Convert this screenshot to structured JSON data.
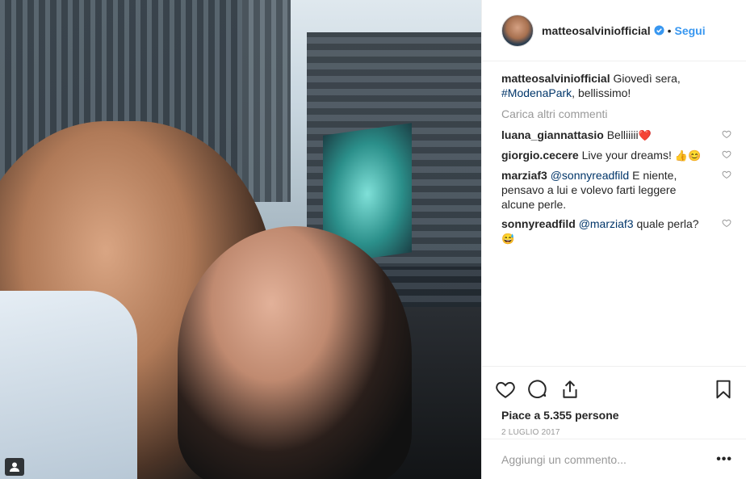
{
  "post": {
    "username": "matteosalviniofficial",
    "follow_label": "Segui",
    "dot": "•",
    "caption_text_before": " Giovedì sera, ",
    "caption_hashtag": "#ModenaPark",
    "caption_text_after": ", bellissimo!",
    "load_more": "Carica altri commenti",
    "comments": [
      {
        "user": "luana_giannattasio",
        "text": " Belliiiii",
        "emoji": "❤️"
      },
      {
        "user": "giorgio.cecere",
        "text": " Live your dreams! ",
        "emoji": "👍😊"
      },
      {
        "user": "marziaf3",
        "mention": "@sonnyreadfild",
        "text": " E niente, pensavo a lui e volevo farti leggere alcune perle.",
        "emoji": ""
      },
      {
        "user": "sonnyreadfild",
        "mention": "@marziaf3",
        "text": " quale perla? ",
        "emoji": "😅"
      }
    ],
    "likes": "Piace a 5.355 persone",
    "date": "2 LUGLIO 2017",
    "comment_placeholder": "Aggiungi un commento...",
    "more_label": "•••"
  },
  "icons": {
    "verified": "verified-badge-icon",
    "like": "heart-icon",
    "comment": "comment-icon",
    "share": "share-icon",
    "save": "bookmark-icon",
    "multi": "user-tag-icon"
  },
  "colors": {
    "accent": "#3897f0",
    "hashtag": "#003569",
    "muted": "#999999",
    "text": "#262626"
  }
}
